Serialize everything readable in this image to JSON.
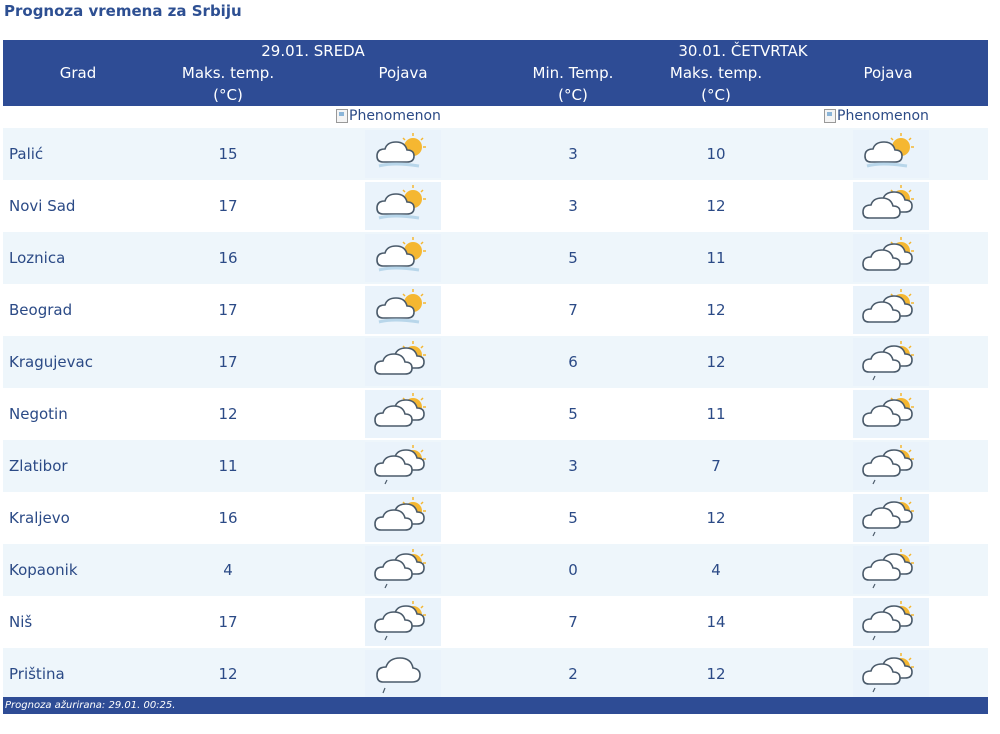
{
  "title": "Prognoza vremena za Srbiju",
  "header": {
    "col_city": "Grad",
    "day1": {
      "date": "29.01. SREDA",
      "max_label": "Maks. temp.",
      "unit": "(°C)",
      "phen_label": "Pojava"
    },
    "day2": {
      "date": "30.01. ČETVRTAK",
      "min_label": "Min. Temp.",
      "max_label": "Maks. temp.",
      "unit_min": "(°C)",
      "unit_max": "(°C)",
      "phen_label": "Pojava"
    }
  },
  "broken_image_alt": "Phenomenon",
  "rows": [
    {
      "city": "Palić",
      "d1_max": "15",
      "d1_icon": "partly-sunny-icon",
      "d2_min": "3",
      "d2_max": "10",
      "d2_icon": "partly-sunny-icon"
    },
    {
      "city": "Novi Sad",
      "d1_max": "17",
      "d1_icon": "partly-sunny-icon",
      "d2_min": "3",
      "d2_max": "12",
      "d2_icon": "mostly-cloudy-icon"
    },
    {
      "city": "Loznica",
      "d1_max": "16",
      "d1_icon": "partly-sunny-icon",
      "d2_min": "5",
      "d2_max": "11",
      "d2_icon": "mostly-cloudy-icon"
    },
    {
      "city": "Beograd",
      "d1_max": "17",
      "d1_icon": "partly-sunny-icon",
      "d2_min": "7",
      "d2_max": "12",
      "d2_icon": "mostly-cloudy-icon"
    },
    {
      "city": "Kragujevac",
      "d1_max": "17",
      "d1_icon": "mostly-cloudy-icon",
      "d2_min": "6",
      "d2_max": "12",
      "d2_icon": "cloudy-drizzle-icon"
    },
    {
      "city": "Negotin",
      "d1_max": "12",
      "d1_icon": "mostly-cloudy-icon",
      "d2_min": "5",
      "d2_max": "11",
      "d2_icon": "mostly-cloudy-icon"
    },
    {
      "city": "Zlatibor",
      "d1_max": "11",
      "d1_icon": "cloudy-drizzle-icon",
      "d2_min": "3",
      "d2_max": "7",
      "d2_icon": "cloudy-drizzle-icon"
    },
    {
      "city": "Kraljevo",
      "d1_max": "16",
      "d1_icon": "mostly-cloudy-icon",
      "d2_min": "5",
      "d2_max": "12",
      "d2_icon": "cloudy-drizzle-icon"
    },
    {
      "city": "Kopaonik",
      "d1_max": "4",
      "d1_icon": "cloudy-drizzle-icon",
      "d2_min": "0",
      "d2_max": "4",
      "d2_icon": "cloudy-drizzle-icon"
    },
    {
      "city": "Niš",
      "d1_max": "17",
      "d1_icon": "cloudy-drizzle-icon",
      "d2_min": "7",
      "d2_max": "14",
      "d2_icon": "cloudy-drizzle-icon"
    },
    {
      "city": "Priština",
      "d1_max": "12",
      "d1_icon": "cloud-drizzle-icon",
      "d2_min": "2",
      "d2_max": "12",
      "d2_icon": "cloudy-drizzle-icon"
    }
  ],
  "footer": "Prognoza ažurirana: 29.01. 00:25.",
  "colors": {
    "header_bg": "#2e4c95",
    "row_alt": "#eef6fb",
    "text": "#2b4a86",
    "sun": "#f5b731"
  }
}
